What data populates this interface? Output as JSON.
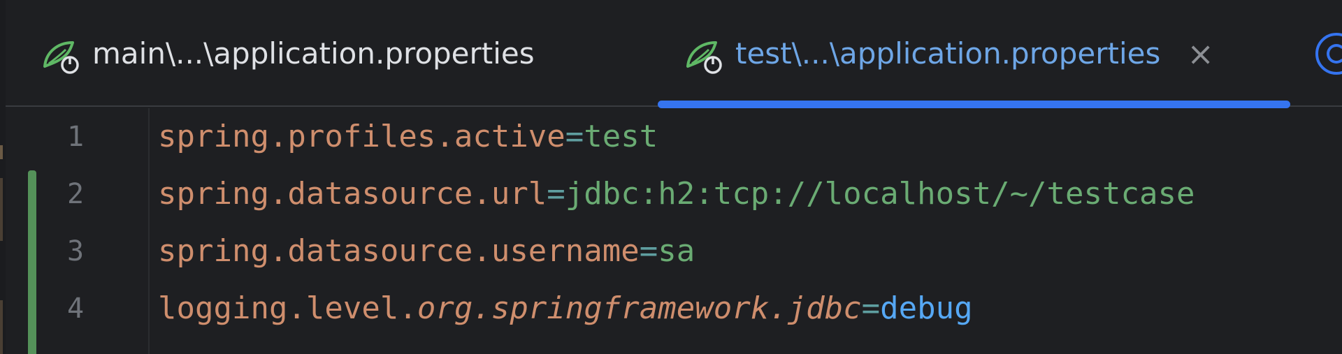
{
  "tabs": [
    {
      "label": "main\\...\\application.properties",
      "active": false,
      "icon": "spring-boot-icon"
    },
    {
      "label": "test\\...\\application.properties",
      "active": true,
      "icon": "spring-boot-icon",
      "close_label": "×"
    },
    {
      "label": "",
      "icon": "class-icon",
      "partial": true
    }
  ],
  "editor": {
    "lines": [
      {
        "number": "1",
        "key": "spring.profiles.active",
        "eq": "=",
        "value": "test"
      },
      {
        "number": "2",
        "key": "spring.datasource.url",
        "eq": "=",
        "value": "jdbc:h2:tcp://localhost/~/testcase"
      },
      {
        "number": "3",
        "key": "spring.datasource.username",
        "eq": "=",
        "value": "sa"
      },
      {
        "number": "4",
        "key_plain": "logging.level.",
        "key_italic": "org.springframework.jdbc",
        "eq": "=",
        "value": "debug"
      }
    ]
  },
  "colors": {
    "background": "#1e1f22",
    "key": "#cf8e6d",
    "value": "#6aab73",
    "accent": "#3574f0",
    "change_marker": "#549159"
  }
}
